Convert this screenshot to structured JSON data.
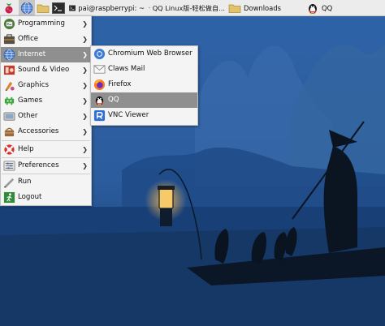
{
  "taskbar": {
    "terminal_title": "pai@raspberrypi: ~",
    "qq_window_title": "QQ Linux版-轻松做自...",
    "files_window_title": "Downloads",
    "qq_tray_title": "QQ"
  },
  "main_menu": {
    "items": [
      {
        "label": "Programming",
        "icon": "programming-icon",
        "submenu": true
      },
      {
        "label": "Office",
        "icon": "office-icon",
        "submenu": true
      },
      {
        "label": "Internet",
        "icon": "internet-globe-icon",
        "submenu": true,
        "highlighted": true
      },
      {
        "label": "Sound & Video",
        "icon": "sound-video-icon",
        "submenu": true
      },
      {
        "label": "Graphics",
        "icon": "graphics-icon",
        "submenu": true
      },
      {
        "label": "Games",
        "icon": "games-icon",
        "submenu": true
      },
      {
        "label": "Other",
        "icon": "other-icon",
        "submenu": true
      },
      {
        "label": "Accessories",
        "icon": "accessories-icon",
        "submenu": true
      },
      {
        "label": "Help",
        "icon": "help-lifebuoy-icon",
        "submenu": true
      },
      {
        "label": "Preferences",
        "icon": "preferences-icon",
        "submenu": true
      },
      {
        "label": "Run",
        "icon": "run-icon",
        "submenu": false
      },
      {
        "label": "Logout",
        "icon": "logout-icon",
        "submenu": false
      }
    ],
    "arrow_glyph": "❯"
  },
  "internet_submenu": {
    "items": [
      {
        "label": "Chromium Web Browser",
        "icon": "chromium-icon"
      },
      {
        "label": "Claws Mail",
        "icon": "mail-envelope-icon"
      },
      {
        "label": "Firefox",
        "icon": "firefox-icon"
      },
      {
        "label": "QQ",
        "icon": "qq-penguin-icon",
        "highlighted": true
      },
      {
        "label": "VNC Viewer",
        "icon": "vnc-viewer-icon"
      }
    ]
  },
  "colors": {
    "taskbar_bg": "#ececec",
    "menu_bg": "#f4f4f4",
    "highlight_bg": "#8f8f8f",
    "wallpaper_sky": "#2d5fa3",
    "wallpaper_water": "#163a6e"
  }
}
